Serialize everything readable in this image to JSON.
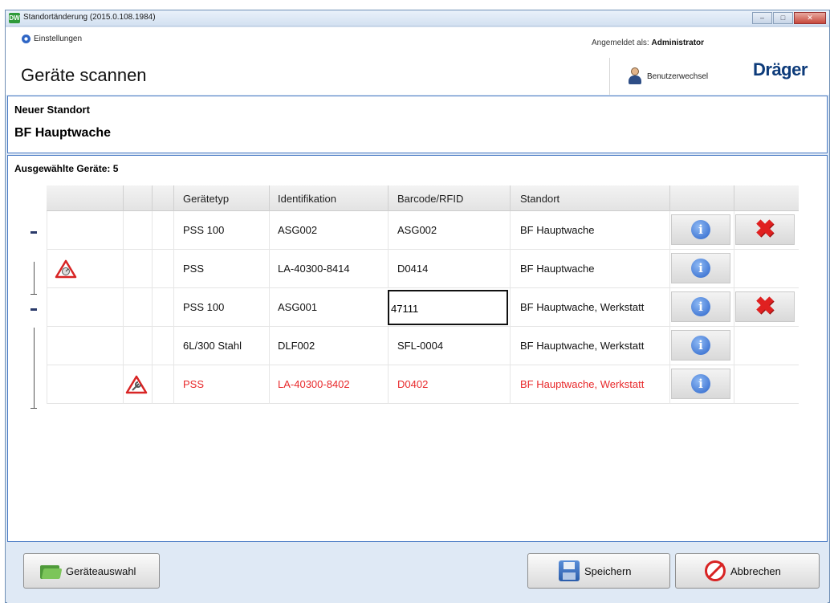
{
  "window": {
    "title": "Standortänderung (2015.0.108.1984)",
    "app_icon": "DW",
    "controls": [
      "minimize-icon",
      "maximize-icon",
      "close-icon"
    ]
  },
  "header": {
    "settings_label": "Einstellungen",
    "page_title": "Geräte scannen",
    "logged_in_prefix": "Angemeldet als:",
    "logged_in_user": "Administrator",
    "user_switch_label": "Benutzerwechsel",
    "logo": "Dräger"
  },
  "location": {
    "label": "Neuer Standort",
    "value": "BF Hauptwache"
  },
  "devices": {
    "label": "Ausgewählte Geräte: 5",
    "columns": [
      "Gerätetyp",
      "Identifikation",
      "Barcode/RFID",
      "Standort"
    ],
    "rows": [
      {
        "type": "PSS 100",
        "id": "ASG002",
        "barcode": "ASG002",
        "location": "BF Hauptwache",
        "warning": false,
        "red": false,
        "deletable": true
      },
      {
        "type": "PSS",
        "id": "LA-40300-8414",
        "barcode": "D0414",
        "location": "BF Hauptwache",
        "warning": true,
        "red": false,
        "deletable": false
      },
      {
        "type": "PSS 100",
        "id": "ASG001",
        "barcode": "47111",
        "location": "BF Hauptwache, Werkstatt",
        "warning": false,
        "red": false,
        "deletable": true,
        "editing": true
      },
      {
        "type": "6L/300 Stahl",
        "id": "DLF002",
        "barcode": "SFL-0004",
        "location": "BF Hauptwache, Werkstatt",
        "warning": false,
        "red": false,
        "deletable": false
      },
      {
        "type": "PSS",
        "id": "LA-40300-8402",
        "barcode": "D0402",
        "location": "BF Hauptwache, Werkstatt",
        "warning": true,
        "red": true,
        "deletable": false
      }
    ]
  },
  "footer": {
    "select_label": "Geräteauswahl",
    "save_label": "Speichern",
    "cancel_label": "Abbrechen"
  },
  "colors": {
    "accent_border": "#4a7bc4",
    "error_red": "#e8282a",
    "brand_blue": "#0d3b7a"
  }
}
